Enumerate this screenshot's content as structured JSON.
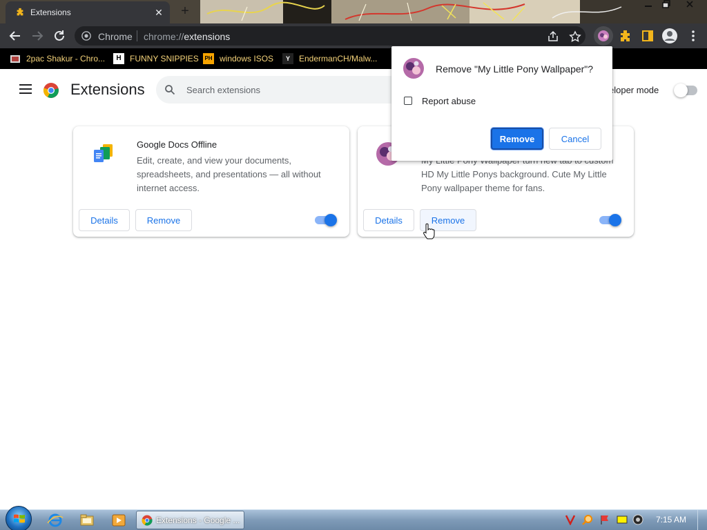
{
  "browser": {
    "tab_title": "Extensions",
    "tab_close_glyph": "✕",
    "new_tab_glyph": "+",
    "window_buttons": [
      "minimize-button",
      "maximize-button",
      "close-button"
    ]
  },
  "toolbar": {
    "site_label": "Chrome",
    "url_prefix": "chrome://",
    "url_highlight": "extensions"
  },
  "bookmarks": [
    {
      "label": "2pac Shakur - Chro...",
      "icon": "2pac-bookmark-icon"
    },
    {
      "label": "FUNNY SNIPPIES",
      "icon": "funny-snippies-icon",
      "icon_text": "H"
    },
    {
      "label": "windows ISOS",
      "icon": "windows-isos-icon",
      "icon_text": "PH"
    },
    {
      "label": "EndermanCH/Malw...",
      "icon": "endermanch-icon",
      "icon_text": "Y"
    }
  ],
  "page": {
    "title": "Extensions",
    "search_placeholder": "Search extensions",
    "devmode_label": "eloper mode",
    "devmode_on": false
  },
  "extensions": [
    {
      "name": "Google Docs Offline",
      "description": "Edit, create, and view your documents, spreadsheets, and presentations — all without internet access.",
      "details_label": "Details",
      "remove_label": "Remove",
      "enabled": true
    },
    {
      "name": "",
      "description": "My Little Pony Wallpaper turn new tab to custom HD My Little Ponys background. Cute My Little Pony wallpaper theme for fans.",
      "details_label": "Details",
      "remove_label": "Remove",
      "enabled": true
    }
  ],
  "dialog": {
    "title": "Remove \"My Little Pony Wallpaper\"?",
    "checkbox_label": "Report abuse",
    "checkbox_checked": false,
    "remove_label": "Remove",
    "cancel_label": "Cancel"
  },
  "taskbar": {
    "chrome_window_label": "Extensions - Google ...",
    "clock": "7:15 AM"
  },
  "colors": {
    "accent": "#1a73e8",
    "toolbar_bg": "#35363a",
    "bookmark_text": "#f5d37a"
  }
}
